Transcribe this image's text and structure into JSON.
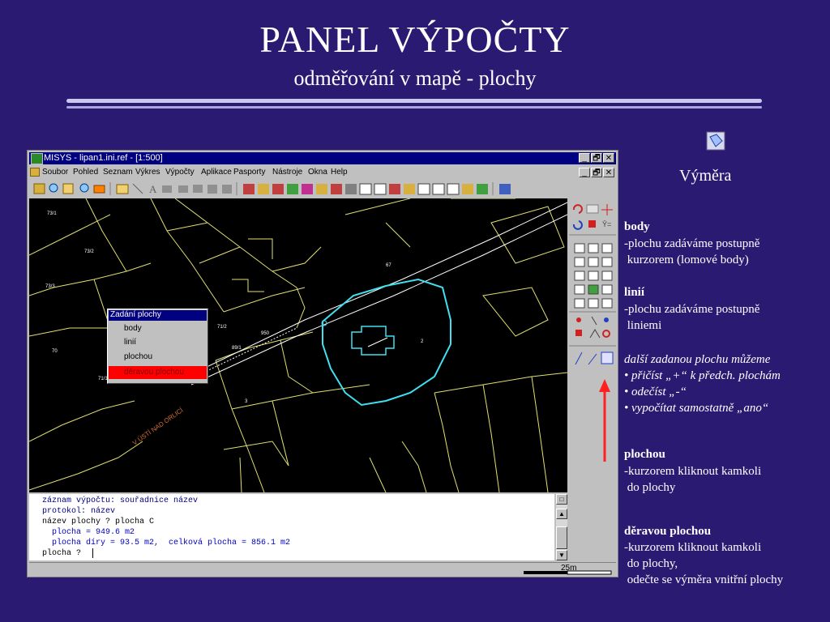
{
  "slide": {
    "title": "PANEL  VÝPOČTY",
    "subtitle": "odměřování v mapě - plochy"
  },
  "window": {
    "title": "MISYS - lipan1.ini.ref - [1:500]",
    "controls": {
      "minimize": "_",
      "restore": "🗗",
      "close": "✕"
    },
    "menu": [
      "Soubor",
      "Pohled",
      "Seznam",
      "Výkres",
      "Výpočty",
      "Aplikace",
      "Pasporty",
      "Nástroje",
      "Okna",
      "Help"
    ]
  },
  "map": {
    "labels": [
      "73/1",
      "73/2",
      "73/3",
      "70",
      "71/1",
      "67",
      "71/2",
      "950",
      "89/1",
      "2",
      "3",
      "V ÚSTÍ NAD ORLICÍ"
    ]
  },
  "popup": {
    "title": "Zadání plochy",
    "items": [
      "body",
      "linií",
      "plochou"
    ],
    "selected": "děravou plochou"
  },
  "console": {
    "lines": [
      "záznam výpočtu: souřadnice název",
      "protokol: název",
      "název plochy ? plocha C",
      "  plocha = 949.6 m2",
      "  plocha díry = 93.5 m2,  celková plocha = 856.1 m2",
      "plocha ? "
    ]
  },
  "statusbar": {
    "scale_label": "25m"
  },
  "sidebar": {
    "heading": "Výměra",
    "body_title": "body",
    "body_line1": "-plochu zadáváme postupně",
    "body_line2": " kurzorem (lomové body)",
    "lines_title": "linií",
    "lines_line1": "-plochu zadáváme postupně",
    "lines_line2": " liniemi",
    "next_area": "další zadanou plochu můžeme",
    "add": "• přičíst „+“ k předch. plochám",
    "subtract": "• odečíst „-“",
    "separate": "• vypočítat samostatně „ano“",
    "area_title": "plochou",
    "area_line1": "-kurzorem kliknout kamkoli",
    "area_line2": " do plochy",
    "hole_title": "děravou plochou",
    "hole_line1": "-kurzorem kliknout kamkoli",
    "hole_line2": " do plochy,",
    "hole_line3": " odečte se výměra vnitřní plochy"
  },
  "colors": {
    "background": "#2a1a72",
    "map_lines": "#e0e070",
    "polygon": "#40e0f0",
    "arrow": "#ff2020"
  }
}
